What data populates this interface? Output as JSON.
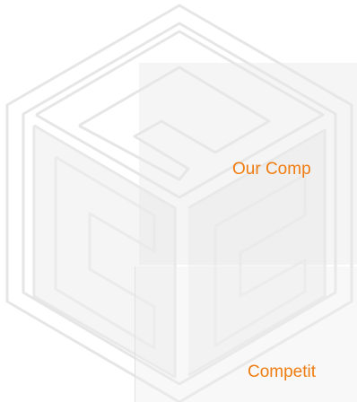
{
  "sections": [
    {
      "id": "our-company",
      "label": "Our Comp"
    },
    {
      "id": "competitors",
      "label": "Competit"
    }
  ],
  "colors": {
    "accent": "#f07d12",
    "watermark_line": "#e6e6e6",
    "panel": "#ececec"
  },
  "watermark": {
    "icon": "cube-logo-icon"
  }
}
